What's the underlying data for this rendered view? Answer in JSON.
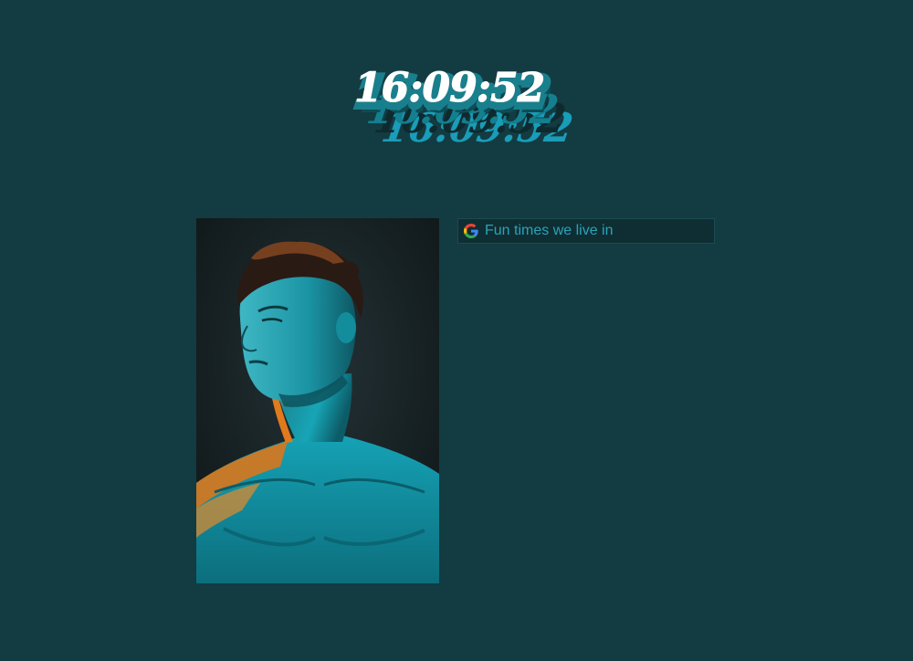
{
  "clock": {
    "time": "16:09:52"
  },
  "photo": {
    "alt": "Portrait of a shirtless man lit with teal and orange light"
  },
  "search": {
    "icon": "google-icon",
    "placeholder": "Fun times we live in",
    "value": ""
  },
  "colors": {
    "background": "#133b42",
    "accent": "#1aa3bf",
    "search_text": "#2aa3b8"
  }
}
